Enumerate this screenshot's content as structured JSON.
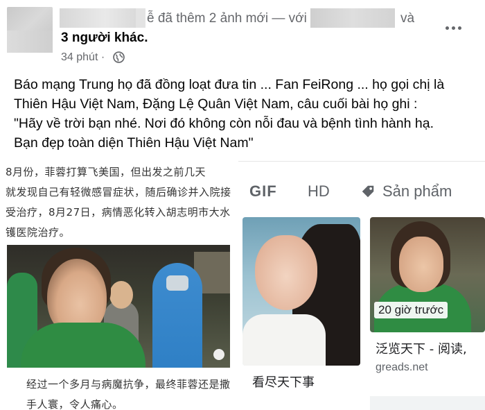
{
  "header": {
    "action_text": "ễ đã thêm 2 ảnh mới — với",
    "and_text": "và",
    "others_link": "3 người khác.",
    "timestamp": "34 phút ·",
    "privacy_icon": "globe-icon",
    "more_icon": "more-options-icon"
  },
  "post": {
    "lines": [
      "Báo mạng Trung họ đã đồng loạt đưa tin ... Fan FeiRong ... họ gọi chị là",
      "Thiên Hậu Việt Nam, Đặng Lệ Quân Việt Nam, câu cuối bài họ ghi :",
      "\"Hãy về trời bạn nhé. Nơi đó không còn nỗi đau và bệnh tình hành hạ.",
      "Bạn đẹp toàn diện Thiên Hậu Việt Nam\""
    ]
  },
  "article": {
    "top_lines": [
      "    8月份，菲蓉打算飞美国，但出发之前几天",
      "就发现自己有轻微感冒症状，随后确诊并入院接",
      "受治疗，8月27日，病情恶化转入胡志明市大水",
      "镬医院治疗。"
    ],
    "bottom_lines": [
      "经过一个多月与病魔抗争，最终菲蓉还是撒",
      "手人寰，令人痛心。"
    ]
  },
  "search": {
    "filters": [
      "GIF",
      "HD",
      "Sản phẩm"
    ],
    "tag_icon": "tag-icon",
    "card_left_caption": "看尽天下事",
    "card_right_time": "20 giờ trước",
    "card_right_caption": "泛览天下 - 阅读,",
    "card_right_source": "greads.net"
  },
  "colors": {
    "primary_text": "#050505",
    "secondary_text": "#65676b",
    "green_shirt": "#2f8c43",
    "ppe_blue": "#2e7fc5"
  }
}
